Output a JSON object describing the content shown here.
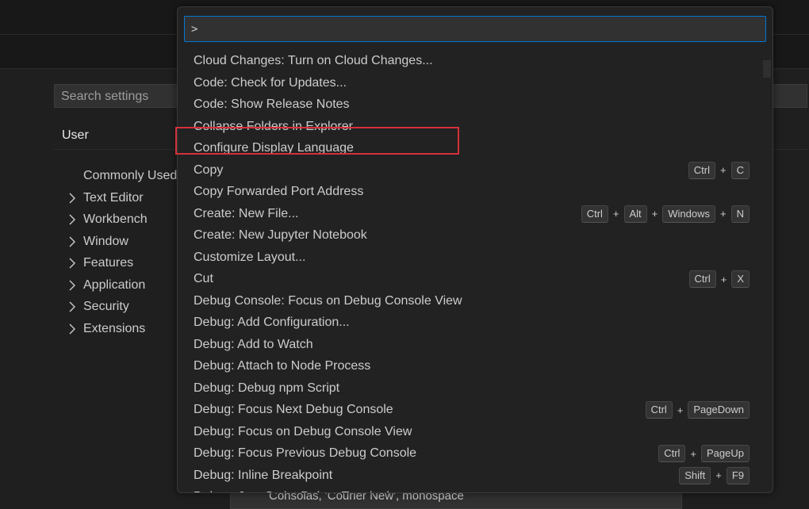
{
  "settings": {
    "search_placeholder": "Search settings",
    "tab_user": "User",
    "toc": [
      {
        "label": "Commonly Used",
        "expandable": false
      },
      {
        "label": "Text Editor",
        "expandable": true
      },
      {
        "label": "Workbench",
        "expandable": true
      },
      {
        "label": "Window",
        "expandable": true
      },
      {
        "label": "Features",
        "expandable": true
      },
      {
        "label": "Application",
        "expandable": true
      },
      {
        "label": "Security",
        "expandable": true
      },
      {
        "label": "Extensions",
        "expandable": true
      }
    ],
    "bottom_field_value": "Consolas, 'Courier New', monospace"
  },
  "palette": {
    "input_value": ">",
    "highlighted_item": "Configure Display Language",
    "commands": [
      {
        "label": "Cloud Changes: Turn on Cloud Changes...",
        "keys": []
      },
      {
        "label": "Code: Check for Updates...",
        "keys": []
      },
      {
        "label": "Code: Show Release Notes",
        "keys": []
      },
      {
        "label": "Collapse Folders in Explorer",
        "keys": []
      },
      {
        "label": "Configure Display Language",
        "keys": []
      },
      {
        "label": "Copy",
        "keys": [
          "Ctrl",
          "C"
        ]
      },
      {
        "label": "Copy Forwarded Port Address",
        "keys": []
      },
      {
        "label": "Create: New File...",
        "keys": [
          "Ctrl",
          "Alt",
          "Windows",
          "N"
        ]
      },
      {
        "label": "Create: New Jupyter Notebook",
        "keys": []
      },
      {
        "label": "Customize Layout...",
        "keys": []
      },
      {
        "label": "Cut",
        "keys": [
          "Ctrl",
          "X"
        ]
      },
      {
        "label": "Debug Console: Focus on Debug Console View",
        "keys": []
      },
      {
        "label": "Debug: Add Configuration...",
        "keys": []
      },
      {
        "label": "Debug: Add to Watch",
        "keys": []
      },
      {
        "label": "Debug: Attach to Node Process",
        "keys": []
      },
      {
        "label": "Debug: Debug npm Script",
        "keys": []
      },
      {
        "label": "Debug: Focus Next Debug Console",
        "keys": [
          "Ctrl",
          "PageDown"
        ]
      },
      {
        "label": "Debug: Focus on Debug Console View",
        "keys": []
      },
      {
        "label": "Debug: Focus Previous Debug Console",
        "keys": [
          "Ctrl",
          "PageUp"
        ]
      },
      {
        "label": "Debug: Inline Breakpoint",
        "keys": [
          "Shift",
          "F9"
        ]
      },
      {
        "label": "Debug: JavaScript Debug Terminal",
        "keys": []
      }
    ]
  },
  "colors": {
    "highlight": "#d3313a",
    "focus_border": "#0078d4"
  }
}
